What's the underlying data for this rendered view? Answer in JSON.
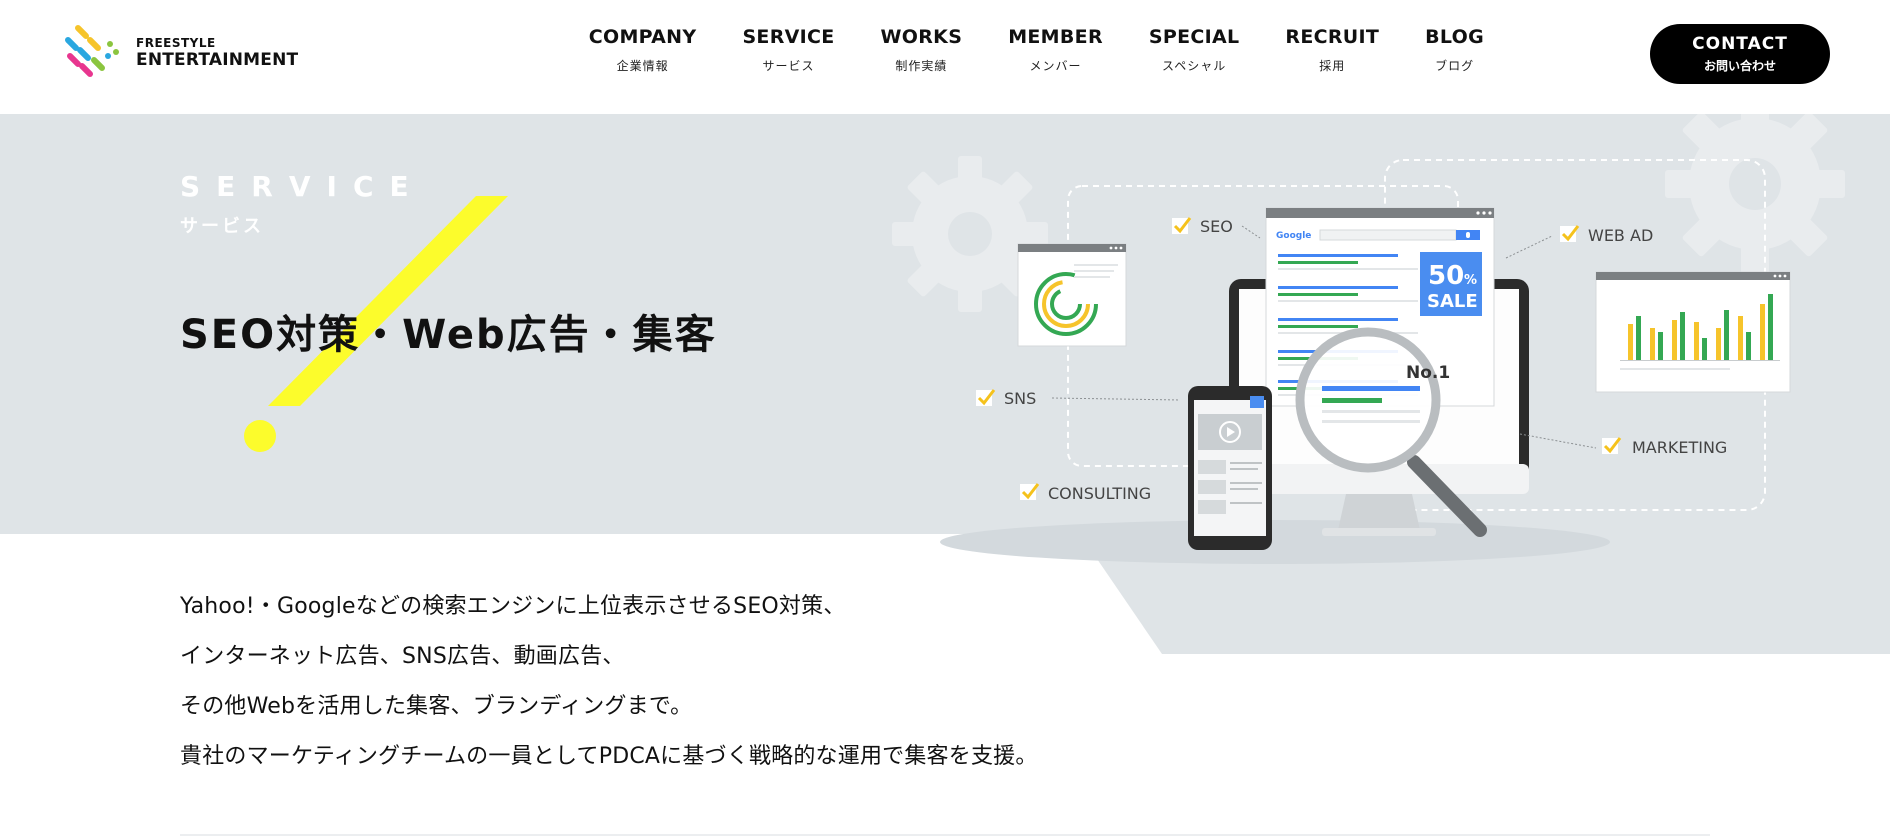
{
  "brand": {
    "line1": "FREESTYLE",
    "line2": "ENTERTAINMENT"
  },
  "nav": {
    "items": [
      {
        "en": "COMPANY",
        "ja": "企業情報"
      },
      {
        "en": "SERVICE",
        "ja": "サービス"
      },
      {
        "en": "WORKS",
        "ja": "制作実績"
      },
      {
        "en": "MEMBER",
        "ja": "メンバー"
      },
      {
        "en": "SPECIAL",
        "ja": "スペシャル"
      },
      {
        "en": "RECRUIT",
        "ja": "採用"
      },
      {
        "en": "BLOG",
        "ja": "ブログ"
      }
    ],
    "contact": {
      "en": "CONTACT",
      "ja": "お問い合わせ"
    }
  },
  "hero": {
    "label_en": "SERVICE",
    "label_ja": "サービス",
    "title": "SEO対策・Web広告・集客"
  },
  "illustration": {
    "tags": {
      "seo": "SEO",
      "web_ad": "WEB AD",
      "sns": "SNS",
      "marketing": "MARKETING",
      "consulting": "CONSULTING"
    },
    "search_brand": "Google",
    "sale_percent": "50",
    "sale_unit": "%",
    "sale_word": "SALE",
    "rank": "No.1"
  },
  "description": [
    "Yahoo!・Googleなどの検索エンジンに上位表示させるSEO対策、",
    "インターネット広告、SNS広告、動画広告、",
    "その他Webを活用した集客、ブランディングまで。",
    "貴社のマーケティングチームの一員としてPDCAに基づく戦略的な運用で集客を支援。"
  ],
  "colors": {
    "accent_yellow": "#fcfc2c",
    "hero_bg": "#dfe4e7",
    "google_blue": "#4285f4",
    "google_green": "#34a853",
    "chart_yellow": "#f6c42b",
    "check_yellow": "#f5c21c"
  },
  "icons": [
    "brand-logo-icon",
    "gear-icon",
    "check-icon",
    "magnifier-icon",
    "play-icon",
    "mic-icon"
  ]
}
